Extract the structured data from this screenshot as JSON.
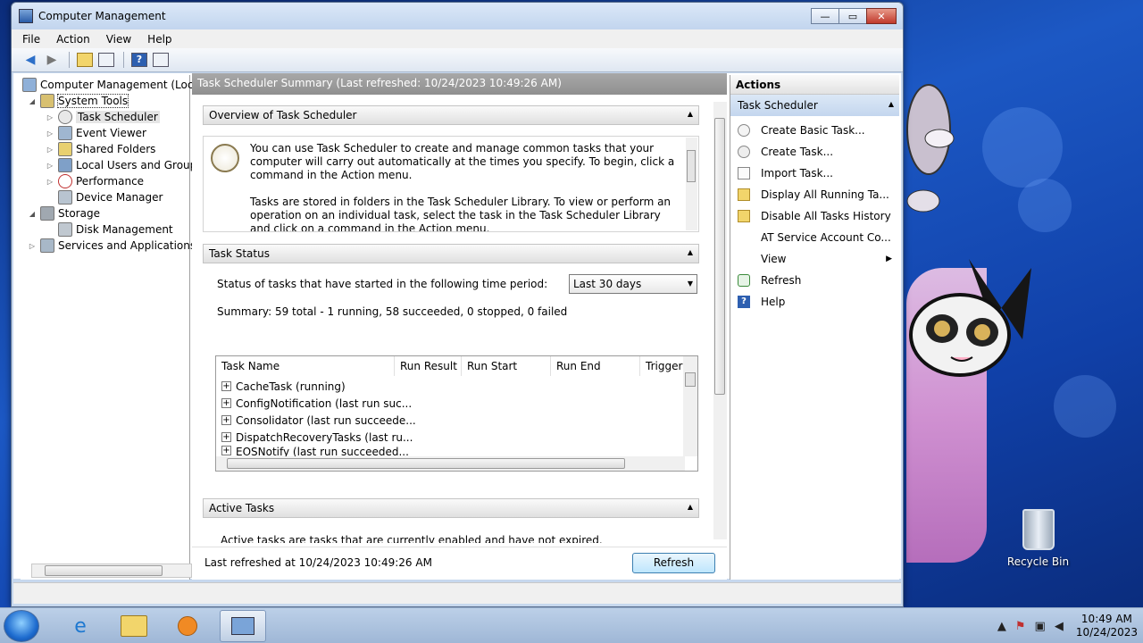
{
  "window": {
    "title": "Computer Management",
    "controls": {
      "minimize": "—",
      "maximize": "▭",
      "close": "✕"
    }
  },
  "menu": [
    "File",
    "Action",
    "View",
    "Help"
  ],
  "toolbar": {
    "back": "◀",
    "forward": "▶",
    "help": "?"
  },
  "tree": {
    "root": "Computer Management (Local",
    "items": [
      {
        "label": "System Tools"
      },
      {
        "label": "Task Scheduler"
      },
      {
        "label": "Event Viewer"
      },
      {
        "label": "Shared Folders"
      },
      {
        "label": "Local Users and Groups"
      },
      {
        "label": "Performance"
      },
      {
        "label": "Device Manager"
      },
      {
        "label": "Storage"
      },
      {
        "label": "Disk Management"
      },
      {
        "label": "Services and Applications"
      }
    ]
  },
  "main": {
    "header": "Task Scheduler Summary (Last refreshed: 10/24/2023 10:49:26 AM)",
    "overview": {
      "title": "Overview of Task Scheduler",
      "p1": "You can use Task Scheduler to create and manage common tasks that your computer will carry out automatically at the times you specify. To begin, click a command in the Action menu.",
      "p2": "Tasks are stored in folders in the Task Scheduler Library. To view or perform an operation on an individual task, select the task in the Task Scheduler Library and click on a command in the Action menu."
    },
    "task_status": {
      "title": "Task Status",
      "period_label": "Status of tasks that have started in the following time period:",
      "period_value": "Last 30 days",
      "summary": "Summary: 59 total - 1 running, 58 succeeded, 0 stopped, 0 failed",
      "columns": [
        "Task Name",
        "Run Result",
        "Run Start",
        "Run End",
        "Trigger"
      ],
      "rows": [
        "CacheTask (running)",
        "ConfigNotification (last run suc...",
        "Consolidator (last run succeede...",
        "DispatchRecoveryTasks (last ru...",
        "EOSNotify (last run succeeded..."
      ]
    },
    "active_tasks": {
      "title": "Active Tasks",
      "text": "Active tasks are tasks that are currently enabled and have not expired."
    },
    "footer": {
      "last_refreshed": "Last refreshed at 10/24/2023 10:49:26 AM",
      "refresh_button": "Refresh"
    }
  },
  "actions": {
    "header": "Actions",
    "section": "Task Scheduler",
    "items": [
      {
        "label": "Create Basic Task...",
        "icon": "create-basic-task-icon"
      },
      {
        "label": "Create Task...",
        "icon": "create-task-icon"
      },
      {
        "label": "Import Task...",
        "icon": "import-task-icon"
      },
      {
        "label": "Display All Running Ta...",
        "icon": "folder-icon"
      },
      {
        "label": "Disable All Tasks History",
        "icon": "folder-icon"
      },
      {
        "label": "AT Service Account Co...",
        "icon": ""
      },
      {
        "label": "View",
        "icon": ""
      },
      {
        "label": "Refresh",
        "icon": "refresh-icon"
      },
      {
        "label": "Help",
        "icon": "help-icon"
      }
    ]
  },
  "desktop": {
    "recycle_bin": "Recycle Bin"
  },
  "taskbar": {
    "time": "10:49 AM",
    "date": "10/24/2023"
  }
}
